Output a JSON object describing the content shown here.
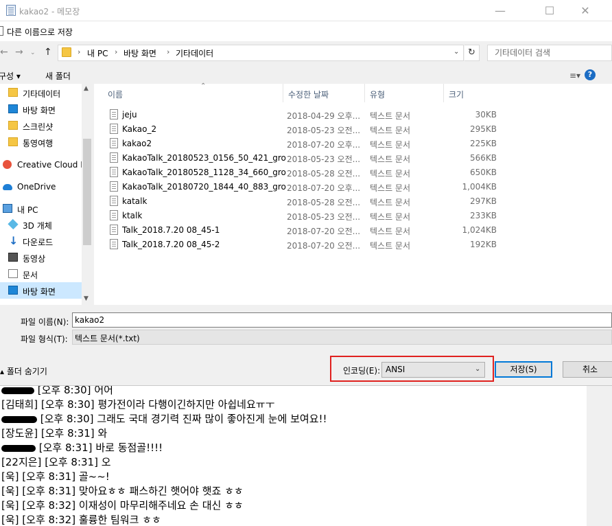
{
  "notepad": {
    "title": "kakao2 - 메모장",
    "lines": [
      {
        "speaker": "",
        "time": "[오후 8:30]",
        "text": "어어"
      },
      {
        "speaker": "[김태희]",
        "time": "[오후 8:30]",
        "text": "평가전이라 다행이긴하지만 아쉽네요ㅠㅜ"
      },
      {
        "speaker": "",
        "time": "[오후 8:30]",
        "text": "그래도 국대 경기력 진짜 많이 좋아진게 눈에 보여요!!"
      },
      {
        "speaker": "[장도윤]",
        "time": "[오후 8:31]",
        "text": "와"
      },
      {
        "speaker": "",
        "time": "[오후 8:31]",
        "text": "바로 동점골!!!!"
      },
      {
        "speaker": "[22지은]",
        "time": "[오후 8:31]",
        "text": "오"
      },
      {
        "speaker": "[욱]",
        "time": "[오후 8:31]",
        "text": "골~~!"
      },
      {
        "speaker": "[욱]",
        "time": "[오후 8:31]",
        "text": "맞아요ㅎㅎ 패스하긴 햇어야 햇죠 ㅎㅎ"
      },
      {
        "speaker": "[욱]",
        "time": "[오후 8:32]",
        "text": "이재성이 마무리해주네요 손 대신 ㅎㅎ"
      },
      {
        "speaker": "[욱]",
        "time": "[오후 8:32]",
        "text": "훌륭한 팀워크 ㅎㅎ"
      }
    ]
  },
  "dialog": {
    "title": "다른 이름으로 저장",
    "address": {
      "crumbs": [
        "내 PC",
        "바탕 화면",
        "기타데이터"
      ],
      "search_placeholder": "기타데이터 검색"
    },
    "toolbar": {
      "organize_label": "구성 ▾",
      "new_folder_label": "새 폴더"
    },
    "nav": [
      {
        "label": "기타데이터",
        "icon": "folder-icon",
        "kind": "folder"
      },
      {
        "label": "바탕 화면",
        "icon": "desktop-icon",
        "kind": "desktop"
      },
      {
        "label": "스크린샷",
        "icon": "folder-icon",
        "kind": "folder"
      },
      {
        "label": "통영여행",
        "icon": "folder-icon",
        "kind": "folder"
      },
      {
        "label": "Creative Cloud Fil",
        "icon": "creative-cloud-icon",
        "kind": "cloud"
      },
      {
        "label": "OneDrive",
        "icon": "onedrive-icon",
        "kind": "onedrive"
      },
      {
        "label": "내 PC",
        "icon": "pc-icon",
        "kind": "pc"
      },
      {
        "label": "3D 개체",
        "icon": "3d-objects-icon",
        "kind": "3d"
      },
      {
        "label": "다운로드",
        "icon": "download-icon",
        "kind": "down"
      },
      {
        "label": "동영상",
        "icon": "video-icon",
        "kind": "video"
      },
      {
        "label": "문서",
        "icon": "document-icon",
        "kind": "doc"
      },
      {
        "label": "바탕 화면",
        "icon": "desktop-icon",
        "kind": "desktop",
        "selected": true
      }
    ],
    "columns": [
      "이름",
      "수정한 날짜",
      "유형",
      "크기"
    ],
    "files": [
      {
        "name": "jeju",
        "date": "2018-04-29 오후...",
        "type": "텍스트 문서",
        "size": "30KB"
      },
      {
        "name": "Kakao_2",
        "date": "2018-05-23 오전...",
        "type": "텍스트 문서",
        "size": "295KB"
      },
      {
        "name": "kakao2",
        "date": "2018-07-20 오후...",
        "type": "텍스트 문서",
        "size": "225KB"
      },
      {
        "name": "KakaoTalk_20180523_0156_50_421_gro",
        "date": "2018-05-23 오전...",
        "type": "텍스트 문서",
        "size": "566KB"
      },
      {
        "name": "KakaoTalk_20180528_1128_34_660_gro",
        "date": "2018-05-28 오전...",
        "type": "텍스트 문서",
        "size": "650KB"
      },
      {
        "name": "KakaoTalk_20180720_1844_40_883_gro",
        "date": "2018-07-20 오후...",
        "type": "텍스트 문서",
        "size": "1,004KB"
      },
      {
        "name": "katalk",
        "date": "2018-05-28 오전...",
        "type": "텍스트 문서",
        "size": "297KB"
      },
      {
        "name": "ktalk",
        "date": "2018-05-23 오전...",
        "type": "텍스트 문서",
        "size": "233KB"
      },
      {
        "name": "Talk_2018.7.20 08_45-1",
        "date": "2018-07-20 오전...",
        "type": "텍스트 문서",
        "size": "1,024KB"
      },
      {
        "name": "Talk_2018.7.20 08_45-2",
        "date": "2018-07-20 오전...",
        "type": "텍스트 문서",
        "size": "192KB"
      }
    ],
    "filename_label": "파일 이름(N):",
    "filename_value": "kakao2",
    "filetype_label": "파일 형식(T):",
    "filetype_value": "텍스트 문서(*.txt)",
    "hide_folders_label": "폴더 숨기기",
    "encoding_label": "인코딩(E):",
    "encoding_value": "ANSI",
    "save_label": "저장(S)",
    "cancel_label": "취소",
    "highlight_color": "#e0201e"
  }
}
